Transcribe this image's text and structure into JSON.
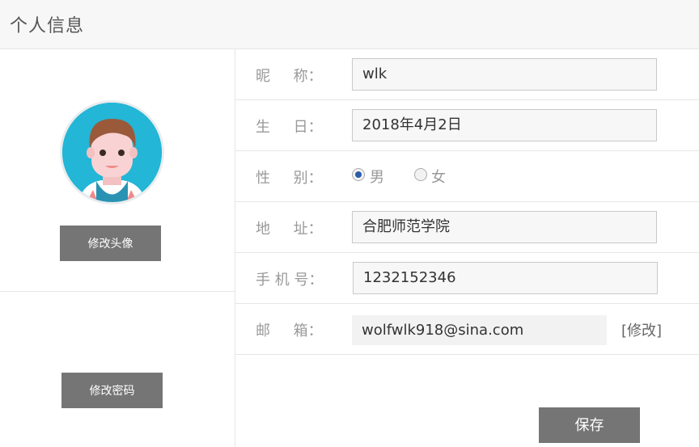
{
  "header": {
    "title": "个人信息"
  },
  "left": {
    "change_avatar_label": "修改头像",
    "change_password_label": "修改密码"
  },
  "form": {
    "nickname": {
      "label": "昵     称：",
      "value": "wlk"
    },
    "birthday": {
      "label": "生     日：",
      "value": "2018年4月2日"
    },
    "gender": {
      "label": "性     别：",
      "options": [
        {
          "label": "男",
          "selected": true
        },
        {
          "label": "女",
          "selected": false
        }
      ]
    },
    "address": {
      "label": "地     址：",
      "value": "合肥师范学院"
    },
    "phone": {
      "label": "手 机 号：",
      "value": "1232152346"
    },
    "email": {
      "label": "邮     箱：",
      "value": "wolfwlk918@sina.com",
      "modify_label": "[修改]"
    },
    "save_label": "保存"
  },
  "colors": {
    "header_bg": "#f7f7f7",
    "button_bg": "#757575",
    "avatar_bg": "#23b6d6",
    "radio_checked": "#2c5cab"
  },
  "icons": {
    "avatar": "cartoon-boy-avatar-icon"
  }
}
